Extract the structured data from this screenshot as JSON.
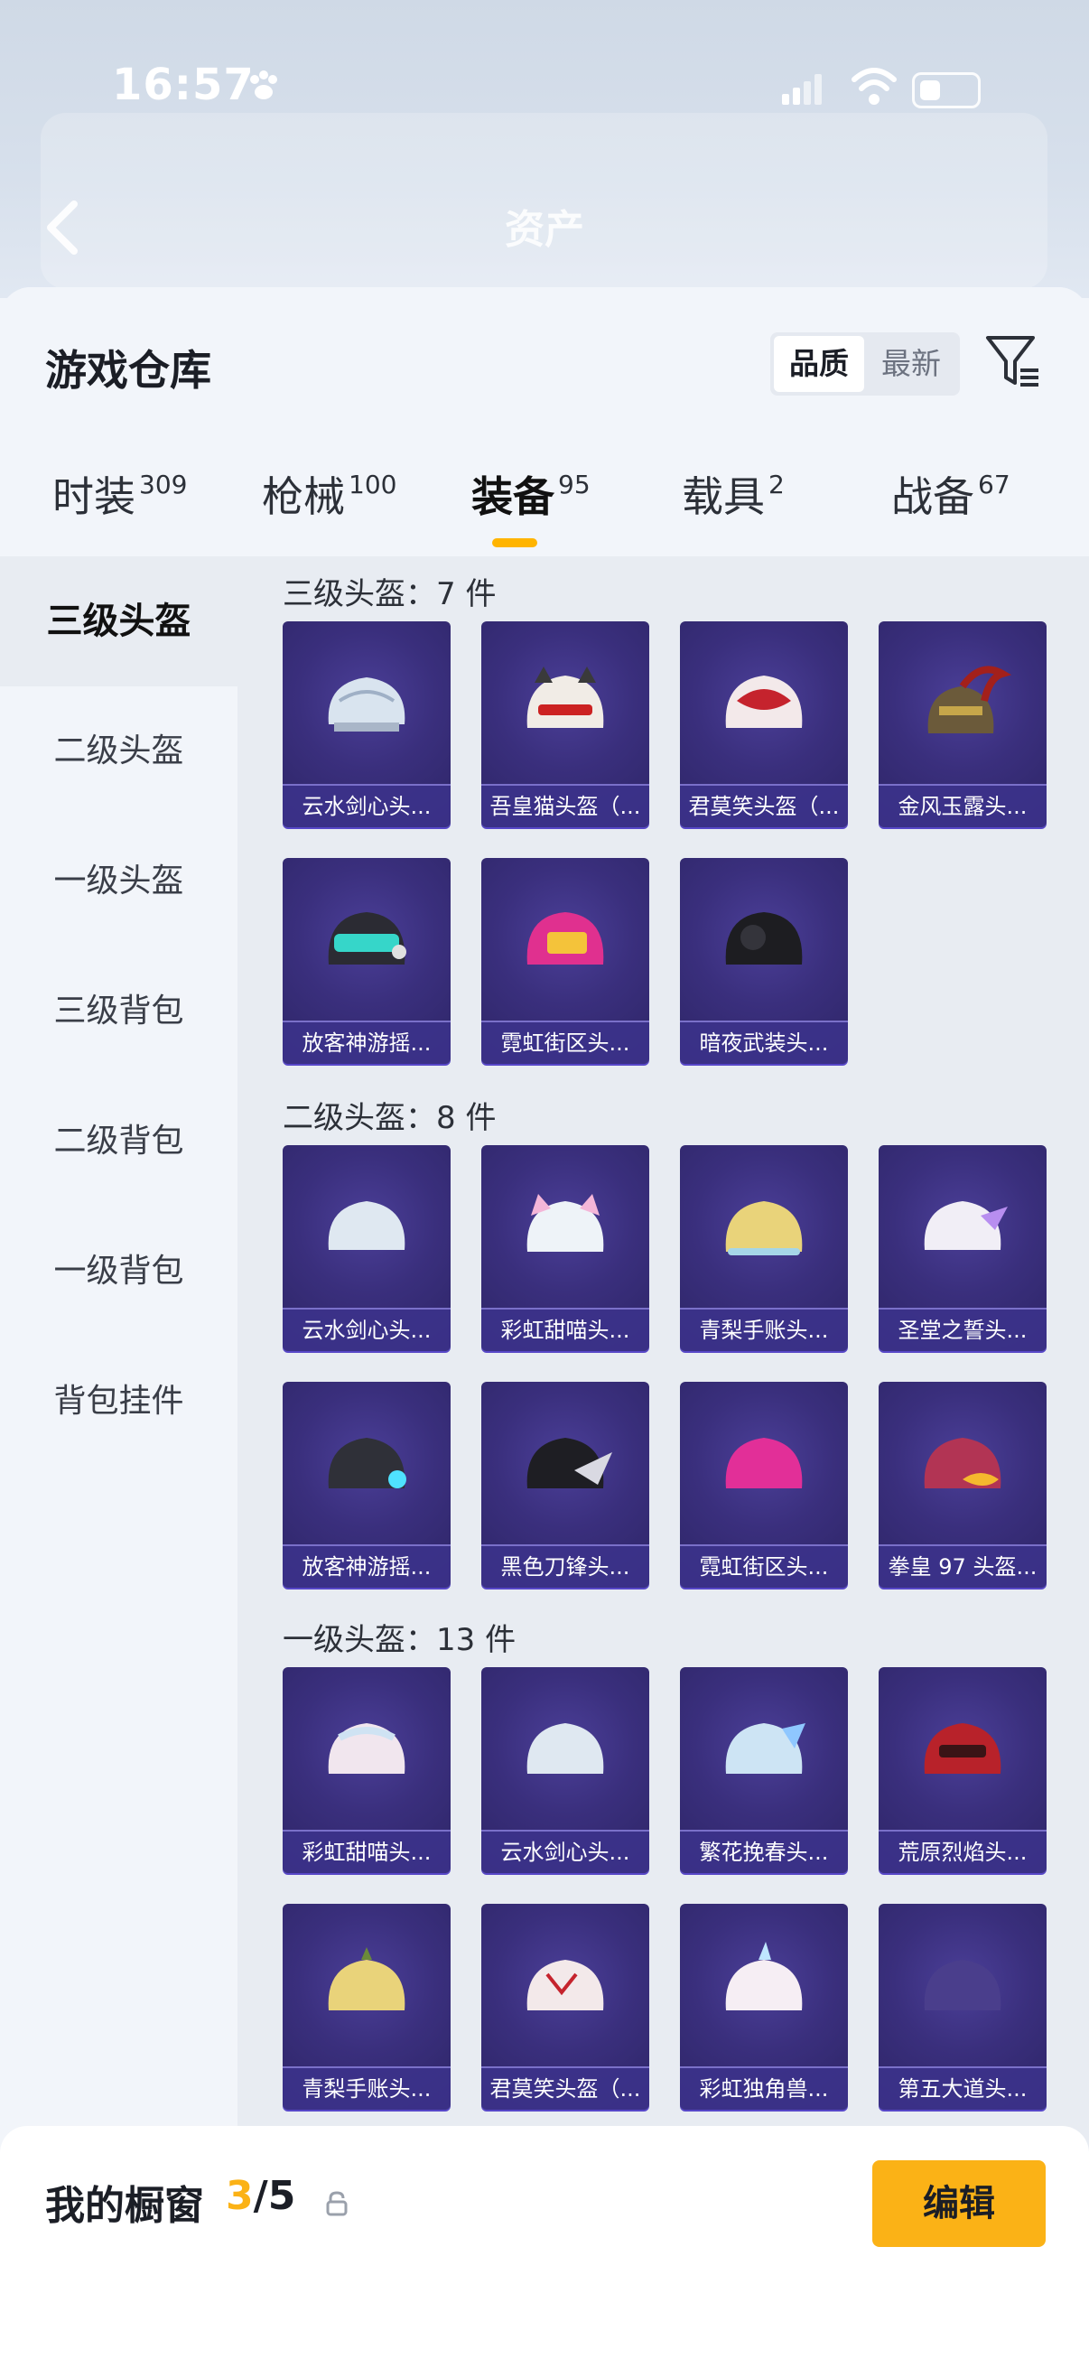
{
  "status": {
    "time": "16:57"
  },
  "nav": {
    "title": "资产"
  },
  "sheet": {
    "title": "游戏仓库",
    "sort": {
      "active": "品质",
      "inactive": "最新"
    }
  },
  "tabs": [
    {
      "label": "时装",
      "count": "309"
    },
    {
      "label": "枪械",
      "count": "100"
    },
    {
      "label": "装备",
      "count": "95"
    },
    {
      "label": "载具",
      "count": "2"
    },
    {
      "label": "战备",
      "count": "67"
    }
  ],
  "sidebar": [
    "三级头盔",
    "二级头盔",
    "一级头盔",
    "三级背包",
    "二级背包",
    "一级背包",
    "背包挂件"
  ],
  "groups": [
    {
      "title": "三级头盔：7 件",
      "items": [
        "云水剑心头...",
        "吾皇猫头盔（...",
        "君莫笑头盔（...",
        "金风玉露头...",
        "放客神游摇...",
        "霓虹街区头...",
        "暗夜武装头..."
      ]
    },
    {
      "title": "二级头盔：8 件",
      "items": [
        "云水剑心头...",
        "彩虹甜喵头...",
        "青梨手账头...",
        "圣堂之誓头...",
        "放客神游摇...",
        "黑色刀锋头...",
        "霓虹街区头...",
        "拳皇 97 头盔..."
      ]
    },
    {
      "title": "一级头盔：13 件",
      "items": [
        "彩虹甜喵头...",
        "云水剑心头...",
        "繁花挽春头...",
        "荒原烈焰头...",
        "青梨手账头...",
        "君莫笑头盔（...",
        "彩虹独角兽...",
        "第五大道头..."
      ]
    }
  ],
  "bottom": {
    "label": "我的橱窗",
    "current": "3",
    "separator": "/",
    "total": "5",
    "edit": "编辑"
  },
  "colors": {
    "accent": "#fbb216",
    "card": "#3a2f7d"
  }
}
